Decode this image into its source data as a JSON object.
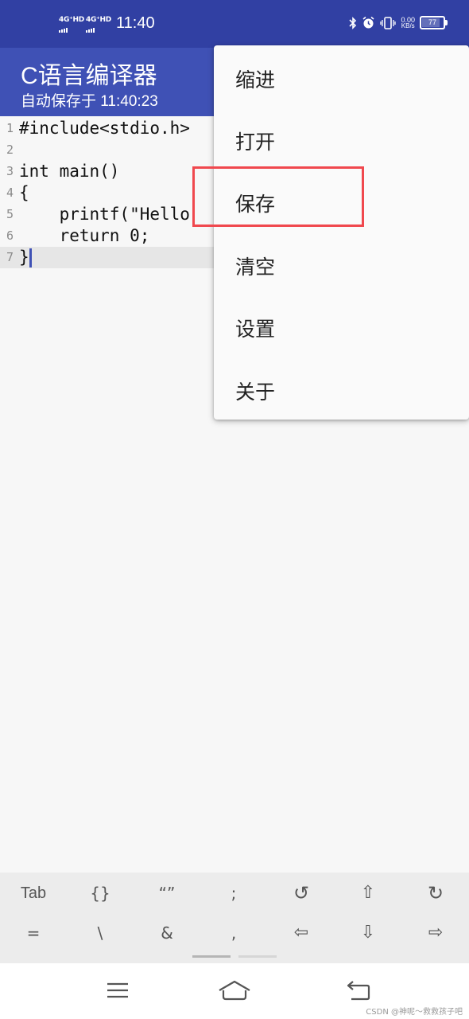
{
  "status_bar": {
    "signal1": "4G⁺HD",
    "signal2": "4G⁺HD",
    "time": "11:40",
    "net_speed": "0.00",
    "net_unit": "KB/s",
    "battery": "77",
    "icons": [
      "bluetooth-icon",
      "alarm-icon",
      "vibrate-icon"
    ]
  },
  "app_bar": {
    "title": "C语言编译器",
    "subtitle": "自动保存于 11:40:23",
    "color": "#3f51b5"
  },
  "editor": {
    "lines": [
      {
        "num": "1",
        "code": "#include<stdio.h>"
      },
      {
        "num": "2",
        "code": ""
      },
      {
        "num": "3",
        "code": "int main()"
      },
      {
        "num": "4",
        "code": "{"
      },
      {
        "num": "5",
        "code": "    printf(\"Hello"
      },
      {
        "num": "6",
        "code": "    return 0;"
      },
      {
        "num": "7",
        "code": "}"
      }
    ]
  },
  "menu": {
    "items": [
      "缩进",
      "打开",
      "保存",
      "清空",
      "设置",
      "关于"
    ],
    "highlighted": "保存",
    "highlight_color": "#f0484e"
  },
  "key_bar": {
    "row1": [
      "Tab",
      "{}",
      "“”",
      ";",
      "↺",
      "⇧",
      "↻"
    ],
    "row2": [
      "=",
      "\\",
      "&",
      ",",
      "⇦",
      "⇩",
      "⇨"
    ]
  },
  "nav_bar": {
    "icons": [
      "menu-icon",
      "home-icon",
      "back-icon"
    ]
  },
  "watermark": "CSDN @神呢～救救孩子吧"
}
